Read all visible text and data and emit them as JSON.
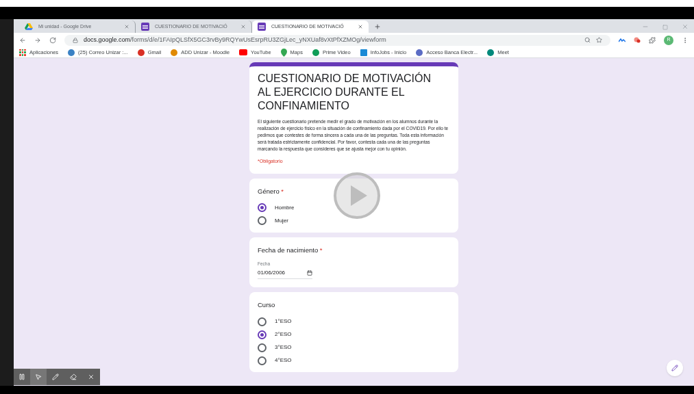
{
  "tabs": [
    {
      "title": "Mi unidad - Google Drive",
      "kind": "drive",
      "selected": false
    },
    {
      "title": "CUESTIONARIO DE MOTIVACIÓ",
      "kind": "forms",
      "selected": false
    },
    {
      "title": "CUESTIONARIO DE MOTIVACIÓ",
      "kind": "forms",
      "selected": true
    }
  ],
  "address_bar": {
    "host": "docs.google.com",
    "path": "/forms/d/e/1FAIpQLSfX5GC3rvBy9RQYwUsEsrpRU3ZGjLec_yNXUaf8vXtPfXZMOg/viewform"
  },
  "profile": {
    "initial": "R"
  },
  "bookmarks": [
    {
      "label": "Aplicaciones",
      "kind": "apps"
    },
    {
      "label": "(25) Correo Unizar :...",
      "kind": "mail"
    },
    {
      "label": "Gmail",
      "kind": "gmail"
    },
    {
      "label": "ADD Unizar - Moodle",
      "kind": "moodle"
    },
    {
      "label": "YouTube",
      "kind": "youtube"
    },
    {
      "label": "Maps",
      "kind": "maps"
    },
    {
      "label": "Prime Video",
      "kind": "prime"
    },
    {
      "label": "InfoJobs - Inicio",
      "kind": "infojobs"
    },
    {
      "label": "Acceso Banca Electr...",
      "kind": "bank"
    },
    {
      "label": "Meet",
      "kind": "meet"
    }
  ],
  "form": {
    "title": "CUESTIONARIO DE MOTIVACIÓN AL EJERCICIO DURANTE EL CONFINAMIENTO",
    "description": "El siguiente cuestionario pretende medir el grado de motivación en los alumnos durante la realización de ejercicio físico en la situación de confinamiento dada por el COVID19. Por ello te pedimos que contestes de forma sincera a cada una de las preguntas. Toda esta información será tratada estrictamente confidencial. Por favor, contesta cada una de las preguntas marcando la respuesta que consideres que se ajusta mejor con tu opinión.",
    "required_note": "*Obligatorio",
    "questions": [
      {
        "kind": "radio",
        "label": "Género",
        "required_mark": "*",
        "options": [
          {
            "label": "Hombre",
            "selected": true
          },
          {
            "label": "Mujer",
            "selected": false
          }
        ]
      },
      {
        "kind": "date",
        "label": "Fecha de nacimiento",
        "required_mark": "*",
        "field_label": "Fecha",
        "value": "01/06/2006"
      },
      {
        "kind": "radio",
        "label": "Curso",
        "options": [
          {
            "label": "1°ESO",
            "selected": false
          },
          {
            "label": "2°ESO",
            "selected": true
          },
          {
            "label": "3°ESO",
            "selected": false
          },
          {
            "label": "4°ESO",
            "selected": false
          }
        ]
      }
    ]
  }
}
